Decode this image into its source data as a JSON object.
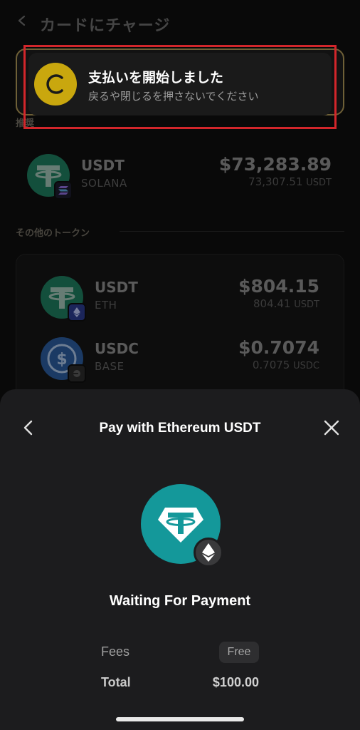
{
  "page": {
    "title": "カードにチャージ",
    "section_recommended": "推奨",
    "section_other": "その他のトークン"
  },
  "recommended_token": {
    "name": "USDT",
    "chain": "SOLANA",
    "usd_value": "$73,283.89",
    "amount": "73,307.51",
    "amount_unit": "USDT"
  },
  "other_tokens": [
    {
      "name": "USDT",
      "chain": "ETH",
      "usd_value": "$804.15",
      "amount": "804.41",
      "amount_unit": "USDT"
    },
    {
      "name": "USDC",
      "chain": "BASE",
      "usd_value": "$0.7074",
      "amount": "0.7075",
      "amount_unit": "USDC"
    }
  ],
  "toast": {
    "title": "支払いを開始しました",
    "subtitle": "戻るや閉じるを押さないでください"
  },
  "sheet": {
    "title": "Pay with Ethereum USDT",
    "status": "Waiting For Payment",
    "fees_label": "Fees",
    "fees_value": "Free",
    "total_label": "Total",
    "total_value": "$100.00"
  },
  "colors": {
    "tether_green": "#1e7a5c",
    "tether_teal": "#14989a",
    "toast_icon": "#c9a70e",
    "highlight_red": "#d2262b"
  }
}
